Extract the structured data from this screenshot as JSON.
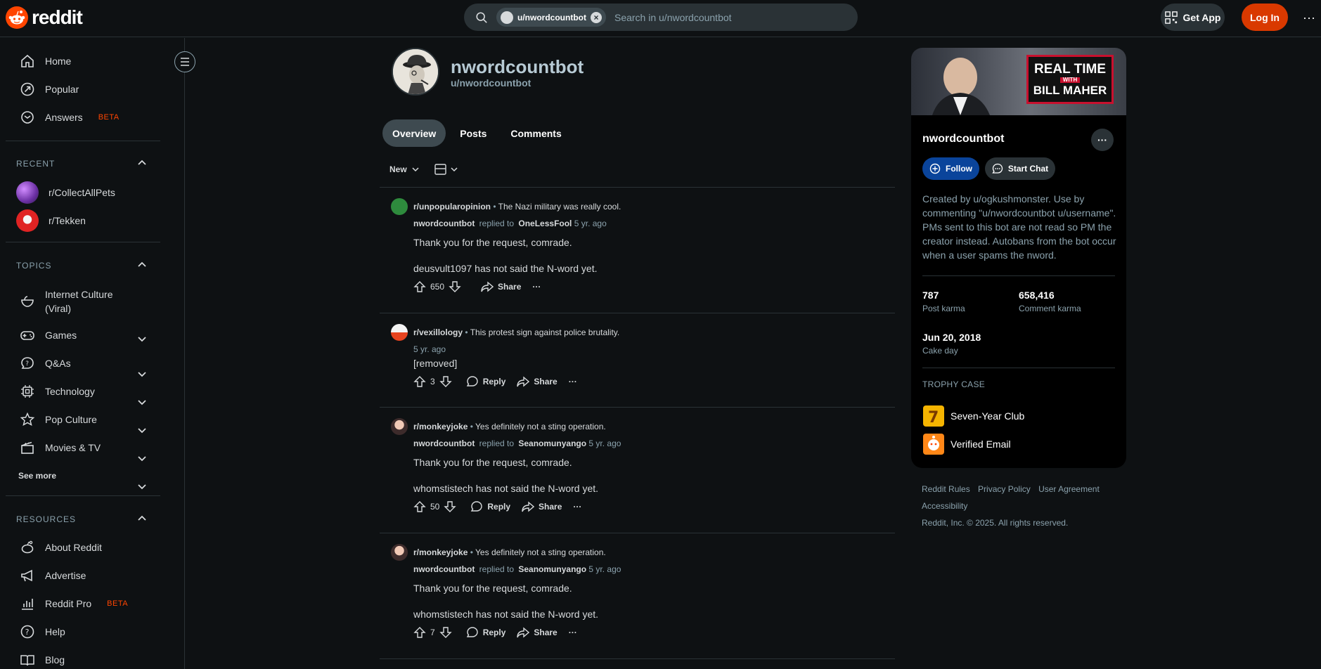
{
  "header": {
    "logo_text": "reddit",
    "search_chip": "u/nwordcountbot",
    "search_placeholder": "Search in u/nwordcountbot",
    "get_app": "Get App",
    "log_in": "Log In",
    "more": "···"
  },
  "sidebar": {
    "nav": [
      {
        "label": "Home",
        "icon": "home-icon"
      },
      {
        "label": "Popular",
        "icon": "popular-icon"
      },
      {
        "label": "Answers",
        "icon": "answers-icon",
        "badge": "BETA"
      }
    ],
    "recent_title": "RECENT",
    "recent": [
      {
        "label": "r/CollectAllPets"
      },
      {
        "label": "r/Tekken"
      }
    ],
    "topics_title": "TOPICS",
    "topics": [
      {
        "label": "Internet Culture (Viral)",
        "icon": "internet-culture-icon"
      },
      {
        "label": "Games",
        "icon": "games-icon"
      },
      {
        "label": "Q&As",
        "icon": "qa-icon"
      },
      {
        "label": "Technology",
        "icon": "technology-icon"
      },
      {
        "label": "Pop Culture",
        "icon": "pop-culture-icon"
      },
      {
        "label": "Movies & TV",
        "icon": "movies-tv-icon"
      }
    ],
    "see_more": "See more",
    "resources_title": "RESOURCES",
    "resources": [
      {
        "label": "About Reddit"
      },
      {
        "label": "Advertise"
      },
      {
        "label": "Reddit Pro",
        "badge": "BETA"
      },
      {
        "label": "Help"
      },
      {
        "label": "Blog"
      }
    ]
  },
  "profile": {
    "name": "nwordcountbot",
    "username": "u/nwordcountbot",
    "tabs": [
      "Overview",
      "Posts",
      "Comments"
    ],
    "sort": "New"
  },
  "feed": [
    {
      "subreddit": "r/unpopularopinion",
      "post_title": "The Nazi military was really cool.",
      "author": "nwordcountbot",
      "replied_to_label": "replied to",
      "replied_to": "OneLessFool",
      "age": "5 yr. ago",
      "line1": "Thank you for the request, comrade.",
      "line2": "deusvult1097 has not said the N-word yet.",
      "votes": "650",
      "share": "Share"
    },
    {
      "subreddit": "r/vexillology",
      "post_title": "This protest sign against police brutality.",
      "age": "5 yr. ago",
      "line1": "[removed]",
      "votes": "3",
      "reply": "Reply",
      "share": "Share"
    },
    {
      "subreddit": "r/monkeyjoke",
      "post_title": "Yes definitely not a sting operation.",
      "author": "nwordcountbot",
      "replied_to_label": "replied to",
      "replied_to": "Seanomunyango",
      "age": "5 yr. ago",
      "line1": "Thank you for the request, comrade.",
      "line2": "whomstistech has not said the N-word yet.",
      "votes": "50",
      "reply": "Reply",
      "share": "Share"
    },
    {
      "subreddit": "r/monkeyjoke",
      "post_title": "Yes definitely not a sting operation.",
      "author": "nwordcountbot",
      "replied_to_label": "replied to",
      "replied_to": "Seanomunyango",
      "age": "5 yr. ago",
      "line1": "Thank you for the request, comrade.",
      "line2": "whomstistech has not said the N-word yet.",
      "votes": "7",
      "reply": "Reply",
      "share": "Share"
    }
  ],
  "right": {
    "banner_text_1": "REAL TIME",
    "banner_text_2": "WITH",
    "banner_text_3": "BILL MAHER",
    "name": "nwordcountbot",
    "follow": "Follow",
    "start_chat": "Start Chat",
    "description": "Created by u/ogkushmonster. Use by commenting \"u/nwordcountbot u/username\". PMs sent to this bot are not read so PM the creator instead. Autobans from the bot occur when a user spams the nword.",
    "post_karma": "787",
    "post_karma_label": "Post karma",
    "comment_karma": "658,416",
    "comment_karma_label": "Comment karma",
    "cake_day": "Jun 20, 2018",
    "cake_day_label": "Cake day",
    "trophy_title": "TROPHY CASE",
    "trophies": [
      "Seven-Year Club",
      "Verified Email"
    ]
  },
  "footer": {
    "links": [
      "Reddit Rules",
      "Privacy Policy",
      "User Agreement",
      "Accessibility"
    ],
    "copyright": "Reddit, Inc. © 2025. All rights reserved."
  },
  "colors": {
    "background": "#0e1113",
    "accent": "#ff4500",
    "login": "#d93900",
    "follow": "#0a449b"
  }
}
